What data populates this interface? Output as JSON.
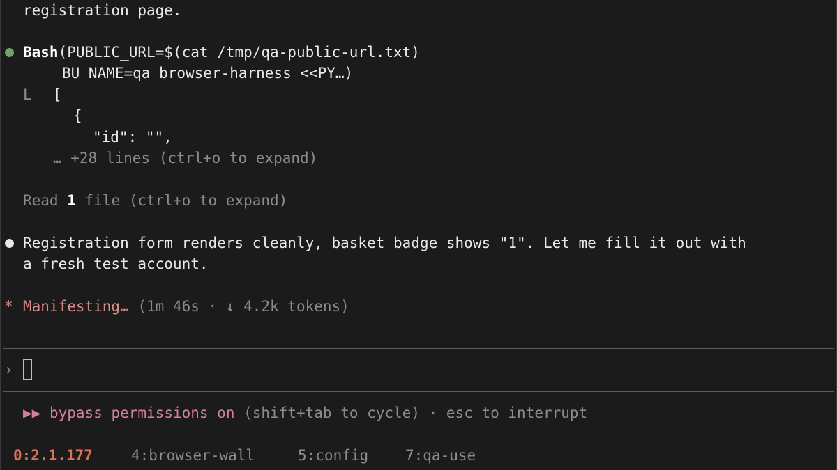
{
  "transcript": {
    "line_top": "registration page.",
    "tool_call": {
      "name": "Bash",
      "args_line1": "(PUBLIC_URL=$(cat /tmp/qa-public-url.txt)",
      "args_line2": "BU_NAME=qa browser-harness <<PY…)",
      "result_prefix": "L",
      "result_lines": [
        "[",
        "{",
        "\"id\": \"\","
      ],
      "collapsed": "… +28 lines (ctrl+o to expand)"
    },
    "read_line": {
      "prefix": "Read ",
      "count": "1",
      "suffix": " file (ctrl+o to expand)"
    },
    "message_line1": "Registration form renders cleanly, basket badge shows \"1\". Let me fill it out with",
    "message_line2": "a fresh test account.",
    "status": {
      "spinner": "*",
      "verb": "Manifesting…",
      "details": "(1m 46s · ↓ 4.2k tokens)"
    }
  },
  "prompt": {
    "symbol": "›",
    "value": ""
  },
  "mode_bar": {
    "arrows": "▶▶",
    "mode": "bypass permissions on",
    "hint": "(shift+tab to cycle) · esc to interrupt"
  },
  "tmux": {
    "session": "0:2.1.177",
    "windows": [
      "4:browser-wall",
      "5:config",
      "7:qa-use"
    ]
  },
  "colors": {
    "background": "#1b1b1b",
    "dot_green": "#6fa36b",
    "status_salmon": "#d98c86",
    "mode_pink": "#d27fa0",
    "tmux_orange": "#e0705a"
  }
}
